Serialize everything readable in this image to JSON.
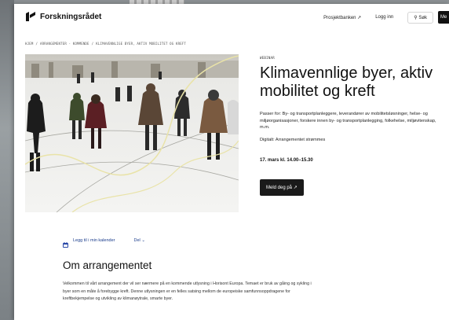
{
  "header": {
    "logo_text": "Forskningsrådet",
    "nav": {
      "projectbank": "Prosjektbanken ↗",
      "login": "Logg inn",
      "search": "Søk",
      "menu": "Me"
    }
  },
  "breadcrumb": [
    "HJEM",
    "ARRANGEMENTER - KOMMENDE",
    "KLIMAVENNLIGE BYER, AKTIV MOBILITET OG KREFT"
  ],
  "hero": {
    "image": "winter-city-square-people-walking"
  },
  "event": {
    "type_label": "WEBINAR",
    "title": "Klimavennlige byer, aktiv mobilitet og kreft",
    "description": "Passer for: By- og transportplanleggere, leverandører av mobilitetsløsninger, helse- og miljøorganisasjoner, forskere innen by- og transportplanlegging, folkehelse, miljøvitenskap, m.m.",
    "stream_note": "Digitalt: Arrangementet strømmes",
    "date_time": "17. mars kl. 14.00–15.30",
    "cta_label": "Meld deg på ↗"
  },
  "calendar": {
    "add_label": "Legg til i min kalender",
    "dropdown_label": "Del"
  },
  "about": {
    "heading": "Om arrangementet",
    "text": "Velkommen til vårt arrangement der vil ser nærmere på en kommende utlysning i Horisont Europa. Temaet er bruk av gåing og sykling i byer som en måte å forebygge kreft. Denne utlysningen er en felles satsing mellom de europeiske samfunnsoppdragene for kreftbekjempelse og utvikling av klimanøytrale, smarte byer."
  },
  "colors": {
    "cta_bg": "#1a1a1a",
    "link": "#1a3c8c",
    "calendar_icon": "#2b4aa8"
  }
}
